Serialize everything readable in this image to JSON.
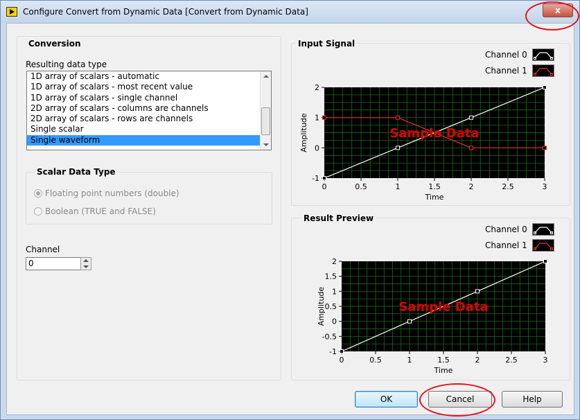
{
  "window": {
    "title": "Configure Convert from Dynamic Data [Convert from Dynamic Data]",
    "close_label": "x"
  },
  "conversion": {
    "heading": "Conversion",
    "list_label": "Resulting data type",
    "items": [
      "1D array of scalars - automatic",
      "1D array of scalars - most recent value",
      "1D array of scalars - single channel",
      "2D array of scalars - columns are channels",
      "2D array of scalars - rows are channels",
      "Single scalar",
      "Single waveform"
    ],
    "selected_index": 6
  },
  "scalar_type": {
    "heading": "Scalar Data Type",
    "options": [
      "Floating point numbers (double)",
      "Boolean (TRUE and FALSE)"
    ],
    "selected_index": 0
  },
  "channel": {
    "label": "Channel",
    "value": "0"
  },
  "input_signal": {
    "heading": "Input Signal",
    "legend": [
      "Channel 0",
      "Channel 1"
    ]
  },
  "result_preview": {
    "heading": "Result Preview",
    "legend": [
      "Channel 0",
      "Channel 1"
    ]
  },
  "buttons": {
    "ok": "OK",
    "cancel": "Cancel",
    "help": "Help"
  },
  "colors": {
    "plot_bg": "#000000",
    "grid": "#1f7a1f",
    "channel0": "#ffffff",
    "channel1": "#e03030"
  },
  "chart_data": [
    {
      "type": "line",
      "title": "",
      "xlabel": "Time",
      "ylabel": "Amplitude",
      "xlim": [
        0,
        3
      ],
      "ylim": [
        -1,
        2
      ],
      "xticks": [
        "0",
        "0.5",
        "1",
        "1.5",
        "2",
        "2.5",
        "3"
      ],
      "yticks": [
        "-1",
        "0",
        "1",
        "2"
      ],
      "series": [
        {
          "name": "Channel 0",
          "x": [
            0,
            1,
            2,
            3
          ],
          "y": [
            -1,
            0,
            1,
            2
          ]
        },
        {
          "name": "Channel 1",
          "x": [
            0,
            1,
            2,
            3
          ],
          "y": [
            1,
            1,
            0,
            0
          ]
        }
      ],
      "annotation": "Sample Data",
      "grid": true
    },
    {
      "type": "line",
      "title": "",
      "xlabel": "Time",
      "ylabel": "Amplitude",
      "xlim": [
        0,
        3
      ],
      "ylim": [
        -1,
        2
      ],
      "xticks": [
        "0",
        "0.5",
        "1",
        "1.5",
        "2",
        "2.5",
        "3"
      ],
      "yticks": [
        "-1",
        "-0.5",
        "0",
        "0.5",
        "1",
        "1.5",
        "2"
      ],
      "series": [
        {
          "name": "Channel 0",
          "x": [
            0,
            1,
            2,
            3
          ],
          "y": [
            -1,
            0,
            1,
            2
          ]
        }
      ],
      "annotation": "Sample Data",
      "grid": true
    }
  ]
}
